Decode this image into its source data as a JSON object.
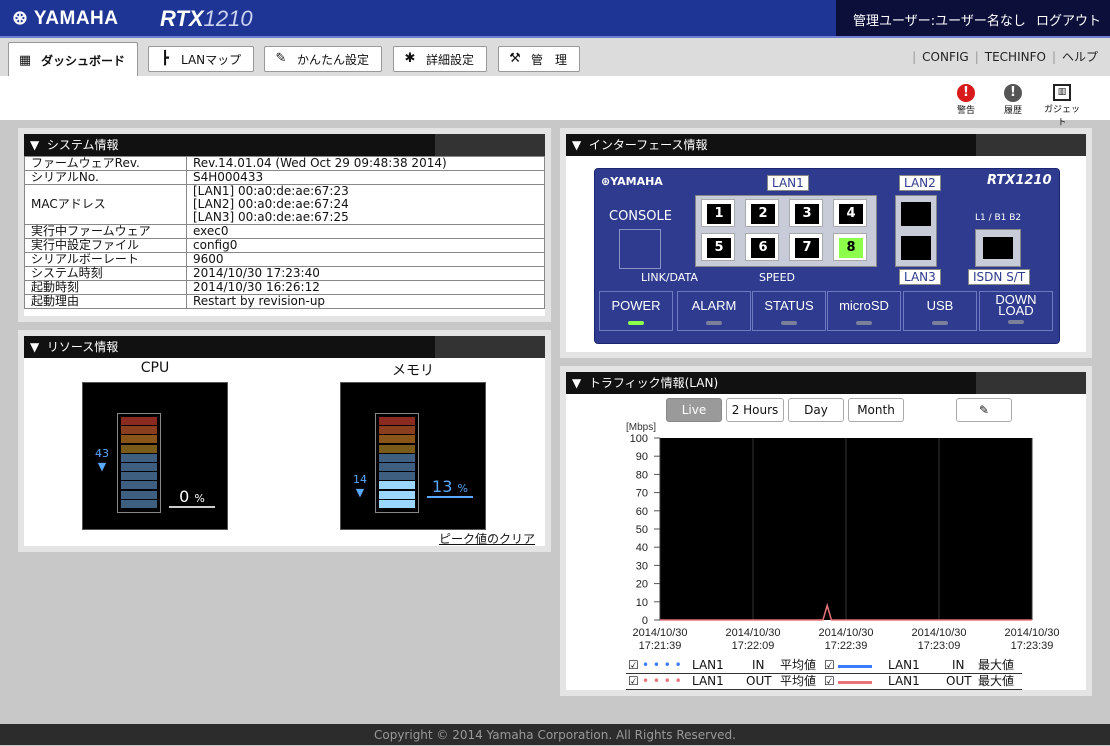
{
  "header": {
    "brand": "YAMAHA",
    "model_prefix": "RTX",
    "model_suffix": "1210",
    "user_info": "管理ユーザー:ユーザー名なし",
    "logout": "ログアウト"
  },
  "nav": {
    "tabs": [
      {
        "label": "ダッシュボード",
        "icon": "dashboard-icon"
      },
      {
        "label": "LANマップ",
        "icon": "lanmap-icon"
      },
      {
        "label": "かんたん設定",
        "icon": "wand-icon"
      },
      {
        "label": "詳細設定",
        "icon": "gear-icon"
      },
      {
        "label": "管　理",
        "icon": "wrench-icon"
      }
    ],
    "links": [
      "CONFIG",
      "TECHINFO",
      "ヘルプ"
    ]
  },
  "quick": {
    "warning": "警告",
    "history": "履歴",
    "gadget": "ガジェット"
  },
  "system": {
    "title": "システム情報",
    "rows": [
      {
        "label": "ファームウェアRev.",
        "value": "Rev.14.01.04 (Wed Oct 29 09:48:38 2014)"
      },
      {
        "label": "シリアルNo.",
        "value": "S4H000433"
      },
      {
        "label": "MACアドレス",
        "value": "[LAN1] 00:a0:de:ae:67:23\n[LAN2] 00:a0:de:ae:67:24\n[LAN3] 00:a0:de:ae:67:25"
      },
      {
        "label": "実行中ファームウェア",
        "value": "exec0"
      },
      {
        "label": "実行中設定ファイル",
        "value": "config0"
      },
      {
        "label": "シリアルボーレート",
        "value": "9600"
      },
      {
        "label": "システム時刻",
        "value": "2014/10/30 17:23:40"
      },
      {
        "label": "起動時刻",
        "value": "2014/10/30 16:26:12"
      },
      {
        "label": "起動理由",
        "value": "Restart by revision-up"
      }
    ]
  },
  "resource": {
    "title": "リソース情報",
    "cpu_label": "CPU",
    "mem_label": "メモリ",
    "cpu_peak": "43",
    "cpu_value": "0",
    "mem_peak": "14",
    "mem_value": "13",
    "unit": "%",
    "clear_peak": "ピーク値のクリア"
  },
  "interface": {
    "title": "インターフェース情報",
    "brand": "YAMAHA",
    "model": "RTX1210",
    "console": "CONSOLE",
    "lan1": "LAN1",
    "lan2": "LAN2",
    "lan3": "LAN3",
    "isdn": "ISDN S/T",
    "isdn_label": "L1 / B1 B2",
    "link_data": "LINK/DATA",
    "speed": "SPEED",
    "ports": [
      "1",
      "2",
      "3",
      "4",
      "5",
      "6",
      "7",
      "8"
    ],
    "lamps": [
      {
        "label": "POWER",
        "on": true
      },
      {
        "label": "ALARM",
        "on": false
      },
      {
        "label": "STATUS",
        "on": false
      },
      {
        "label": "microSD",
        "on": false
      },
      {
        "label": "USB",
        "on": false
      },
      {
        "label": "DOWN\nLOAD",
        "on": false
      }
    ]
  },
  "traffic": {
    "title": "トラフィック情報(LAN)",
    "buttons": [
      "Live",
      "2 Hours",
      "Day",
      "Month"
    ],
    "unit": "[Mbps]",
    "legend": [
      {
        "port": "LAN1",
        "dir": "IN",
        "stat": "平均値",
        "port2": "LAN1",
        "dir2": "IN",
        "stat2": "最大値"
      },
      {
        "port": "LAN1",
        "dir": "OUT",
        "stat": "平均値",
        "port2": "LAN1",
        "dir2": "OUT",
        "stat2": "最大値"
      }
    ]
  },
  "chart_data": {
    "type": "line",
    "ylabel": "[Mbps]",
    "ylim": [
      0,
      100
    ],
    "yticks": [
      0,
      10,
      20,
      30,
      40,
      50,
      60,
      70,
      80,
      90,
      100
    ],
    "xticks": [
      "2014/10/30\n17:21:39",
      "2014/10/30\n17:22:09",
      "2014/10/30\n17:22:39",
      "2014/10/30\n17:23:09",
      "2014/10/30\n17:23:39"
    ],
    "series": [
      {
        "name": "LAN1 OUT 最大値",
        "color": "#e8737b",
        "values": [
          0,
          0,
          0,
          0,
          0,
          0,
          0,
          0,
          0,
          0,
          0,
          0,
          0,
          0,
          0,
          0,
          0,
          0,
          0,
          0,
          0,
          0,
          0,
          0,
          0,
          0,
          0,
          0,
          0,
          0,
          0,
          0,
          0,
          0,
          0,
          0,
          0,
          0,
          0,
          0,
          8,
          0,
          0,
          0,
          0,
          0,
          0,
          0,
          0,
          0,
          0,
          0,
          0,
          0,
          0,
          0,
          0,
          0,
          0,
          0,
          0,
          0,
          0,
          0,
          0,
          0,
          0,
          0,
          0,
          0,
          0,
          0,
          0,
          0,
          0,
          0,
          0,
          0,
          0,
          0,
          0,
          0,
          0,
          0,
          0,
          0,
          0,
          0,
          0,
          0
        ]
      }
    ]
  },
  "footer": "Copyright © 2014 Yamaha Corporation. All Rights Reserved.",
  "colors": {
    "header": "#1f3596",
    "panel_bg": "#2e3b8e",
    "led_on": "#8bff4a"
  }
}
